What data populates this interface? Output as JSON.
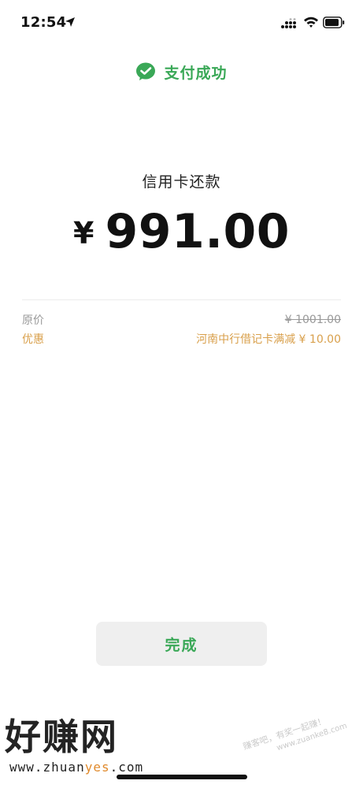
{
  "status_bar": {
    "time": "12:54",
    "icons": [
      "location-arrow-icon",
      "signal-icon",
      "wifi-icon",
      "battery-icon"
    ]
  },
  "header": {
    "success_text": "支付成功",
    "icon": "wechat-pay-icon",
    "accent_color": "#3aa857"
  },
  "payment": {
    "title": "信用卡还款",
    "currency": "¥",
    "amount": "991.00"
  },
  "details": {
    "original_label": "原价",
    "original_value": "¥ 1001.00",
    "discount_label": "优惠",
    "discount_value": "河南中行借记卡满减 ¥ 10.00",
    "discount_color": "#d9a04c"
  },
  "done_button_label": "完成",
  "watermark": {
    "logo_text": "好赚网",
    "url_prefix": "www.zhuan",
    "url_highlight": "yes",
    "url_suffix": ".com",
    "seal_line1": "赚客吧，有奖一起赚！",
    "seal_line2": "www.zuanke8.com"
  }
}
